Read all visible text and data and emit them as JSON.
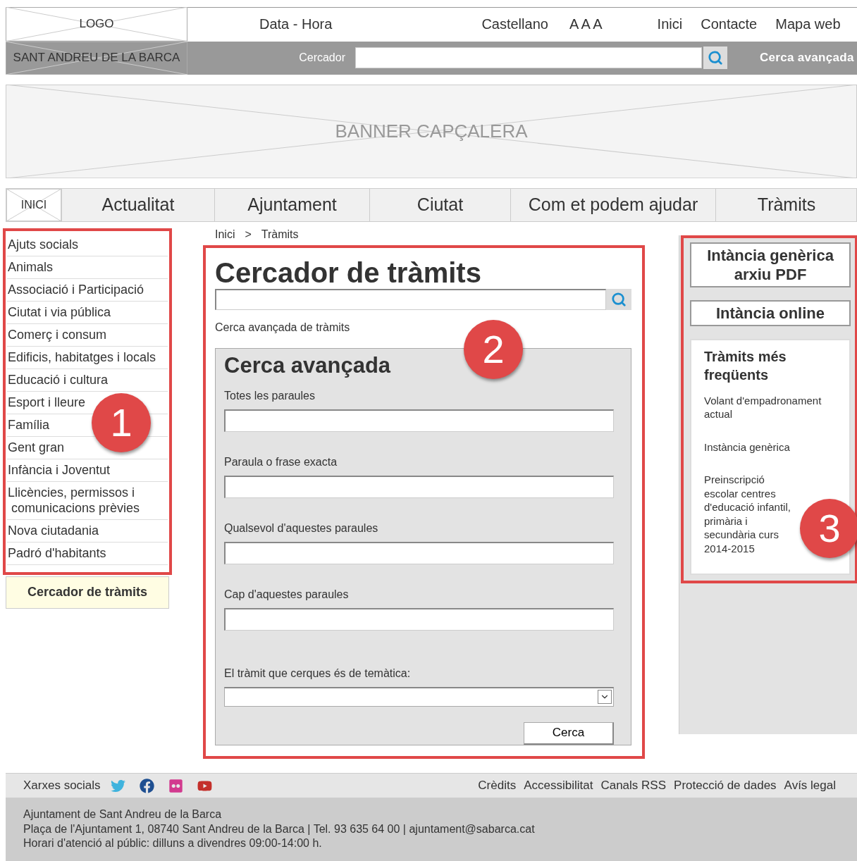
{
  "header": {
    "logo": "LOGO",
    "date_time": "Data - Hora",
    "language": "Castellano",
    "text_size": "A A A",
    "links": [
      "Inici",
      "Contacte",
      "Mapa web"
    ],
    "site_name": "SANT ANDREU DE LA BARCA",
    "search_label": "Cercador",
    "advanced_search": "Cerca avançada"
  },
  "banner": {
    "label": "BANNER CAPÇALERA"
  },
  "nav": {
    "home": "INICI",
    "items": [
      {
        "label": "Actualitat",
        "selected": false
      },
      {
        "label": "Ajuntament",
        "selected": false
      },
      {
        "label": "Ciutat",
        "selected": false
      },
      {
        "label": "Com et podem ajudar",
        "selected": false
      },
      {
        "label": "Tràmits",
        "selected": false
      }
    ]
  },
  "sidebar": {
    "marker": "1",
    "items": [
      "Ajuts socials",
      "Animals",
      "Associació i Participació",
      "Ciutat i via pública",
      "Comerç i consum",
      "Edificis, habitatges i locals",
      "Educació i cultura",
      "Esport i lleure",
      "Família",
      "Gent gran",
      "Infància i Joventut",
      "Llicències, permissos i\n comunicacions prèvies",
      "Nova ciutadania",
      "Padró d'habitants"
    ],
    "button": "Cercador de tràmits"
  },
  "main": {
    "marker": "2",
    "breadcrumb": [
      "Inici",
      ">",
      "Tràmits"
    ],
    "title": "Cercador de tràmits",
    "advanced_link": "Cerca avançada de tràmits",
    "advanced": {
      "title": "Cerca avançada",
      "fields": [
        {
          "label": "Totes les paraules",
          "kind": "text"
        },
        {
          "label": "Paraula o frase exacta",
          "kind": "text"
        },
        {
          "label": "Qualsevol d'aquestes paraules",
          "kind": "text"
        },
        {
          "label": "Cap d'aquestes paraules",
          "kind": "text"
        },
        {
          "label": "El tràmit que cerques és de temàtica:",
          "kind": "select"
        }
      ],
      "button": "Cerca"
    }
  },
  "aside": {
    "marker": "3",
    "buttons": [
      "Intància genèrica arxiu PDF",
      "Intància online"
    ],
    "frequent": {
      "title": "Tràmits més freqüents",
      "links": [
        "Volant d'empadronament actual",
        "Instància genèrica",
        "Preinscripció escolar centres d'educació infantil, primària i secundària curs 2014-2015"
      ]
    }
  },
  "footer": {
    "social_label": "Xarxes socials",
    "links": [
      "Crèdits",
      "Accessibilitat",
      "Canals RSS",
      "Protecció de dades",
      "Avís legal"
    ],
    "address": [
      "Ajuntament de Sant Andreu de la Barca",
      "Plaça de l'Ajuntament 1, 08740 Sant Andreu de la Barca | Tel. 93 635 64 00 | ajuntament@sabarca.cat",
      "Horari d'atenció al públic: dilluns a divendres 09:00-14:00 h."
    ]
  }
}
